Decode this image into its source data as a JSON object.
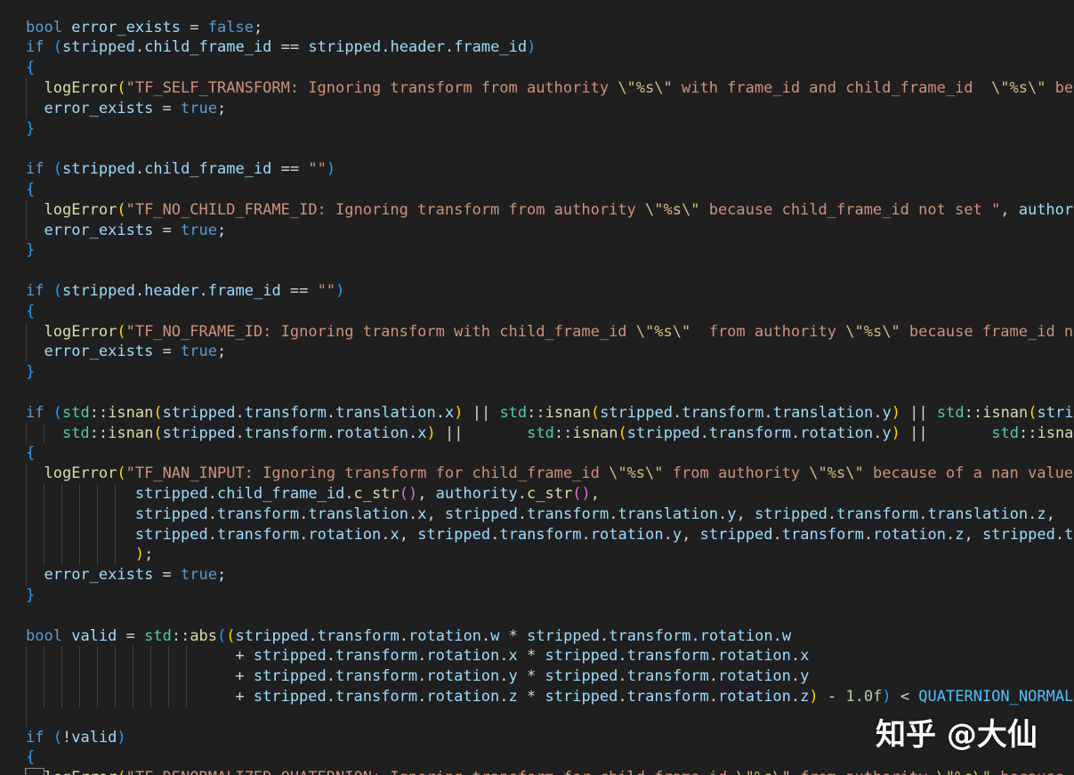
{
  "editor": {
    "colors": {
      "background": "#1f1f1f",
      "keyword": "#569cd6",
      "function": "#dcdcaa",
      "variable": "#9cdcfe",
      "string": "#ce9178",
      "escape": "#d7ba7d",
      "namespace": "#4ec9b0",
      "number": "#b5cea8",
      "bracket_level1": "#ffd700",
      "bracket_level2": "#da70d6",
      "bracket_level3": "#179fff"
    },
    "lines": [
      [
        [
          "k",
          "bool"
        ],
        [
          "p",
          " "
        ],
        [
          "v",
          "error_exists"
        ],
        [
          "p",
          " = "
        ],
        [
          "k",
          "false"
        ],
        [
          "p",
          ";"
        ]
      ],
      [
        [
          "k",
          "if"
        ],
        [
          "p",
          " "
        ],
        [
          "b3",
          "("
        ],
        [
          "v",
          "stripped"
        ],
        [
          "p",
          "."
        ],
        [
          "v",
          "child_frame_id"
        ],
        [
          "p",
          " == "
        ],
        [
          "v",
          "stripped"
        ],
        [
          "p",
          "."
        ],
        [
          "v",
          "header"
        ],
        [
          "p",
          "."
        ],
        [
          "v",
          "frame_id"
        ],
        [
          "b3",
          ")"
        ]
      ],
      [
        [
          "b3",
          "{"
        ]
      ],
      [
        [
          "p",
          "  "
        ],
        [
          "f",
          "logError"
        ],
        [
          "b1",
          "("
        ],
        [
          "s",
          "\"TF_SELF_TRANSFORM: Ignoring transform from authority "
        ],
        [
          "e",
          "\\\""
        ],
        [
          "e",
          "%s"
        ],
        [
          "e",
          "\\\""
        ],
        [
          "s",
          " with frame_id and child_frame_id  "
        ],
        [
          "e",
          "\\\""
        ],
        [
          "e",
          "%s"
        ],
        [
          "e",
          "\\\""
        ],
        [
          "s",
          " because they are the same\""
        ]
      ],
      [
        [
          "p",
          "  "
        ],
        [
          "v",
          "error_exists"
        ],
        [
          "p",
          " = "
        ],
        [
          "k",
          "true"
        ],
        [
          "p",
          ";"
        ]
      ],
      [
        [
          "b3",
          "}"
        ]
      ],
      [],
      [
        [
          "k",
          "if"
        ],
        [
          "p",
          " "
        ],
        [
          "b3",
          "("
        ],
        [
          "v",
          "stripped"
        ],
        [
          "p",
          "."
        ],
        [
          "v",
          "child_frame_id"
        ],
        [
          "p",
          " == "
        ],
        [
          "s",
          "\"\""
        ],
        [
          "b3",
          ")"
        ]
      ],
      [
        [
          "b3",
          "{"
        ]
      ],
      [
        [
          "p",
          "  "
        ],
        [
          "f",
          "logError"
        ],
        [
          "b1",
          "("
        ],
        [
          "s",
          "\"TF_NO_CHILD_FRAME_ID: Ignoring transform from authority "
        ],
        [
          "e",
          "\\\""
        ],
        [
          "e",
          "%s"
        ],
        [
          "e",
          "\\\""
        ],
        [
          "s",
          " because child_frame_id not set \""
        ],
        [
          "p",
          ", "
        ],
        [
          "v",
          "authority"
        ]
      ],
      [
        [
          "p",
          "  "
        ],
        [
          "v",
          "error_exists"
        ],
        [
          "p",
          " = "
        ],
        [
          "k",
          "true"
        ],
        [
          "p",
          ";"
        ]
      ],
      [
        [
          "b3",
          "}"
        ]
      ],
      [],
      [
        [
          "k",
          "if"
        ],
        [
          "p",
          " "
        ],
        [
          "b3",
          "("
        ],
        [
          "v",
          "stripped"
        ],
        [
          "p",
          "."
        ],
        [
          "v",
          "header"
        ],
        [
          "p",
          "."
        ],
        [
          "v",
          "frame_id"
        ],
        [
          "p",
          " == "
        ],
        [
          "s",
          "\"\""
        ],
        [
          "b3",
          ")"
        ]
      ],
      [
        [
          "b3",
          "{"
        ]
      ],
      [
        [
          "p",
          "  "
        ],
        [
          "f",
          "logError"
        ],
        [
          "b1",
          "("
        ],
        [
          "s",
          "\"TF_NO_FRAME_ID: Ignoring transform with child_frame_id "
        ],
        [
          "e",
          "\\\""
        ],
        [
          "e",
          "%s"
        ],
        [
          "e",
          "\\\""
        ],
        [
          "s",
          "  from authority "
        ],
        [
          "e",
          "\\\""
        ],
        [
          "e",
          "%s"
        ],
        [
          "e",
          "\\\""
        ],
        [
          "s",
          " because frame_id not set\""
        ]
      ],
      [
        [
          "p",
          "  "
        ],
        [
          "v",
          "error_exists"
        ],
        [
          "p",
          " = "
        ],
        [
          "k",
          "true"
        ],
        [
          "p",
          ";"
        ]
      ],
      [
        [
          "b3",
          "}"
        ]
      ],
      [],
      [
        [
          "k",
          "if"
        ],
        [
          "p",
          " "
        ],
        [
          "b3",
          "("
        ],
        [
          "c",
          "std"
        ],
        [
          "p",
          "::"
        ],
        [
          "f",
          "isnan"
        ],
        [
          "b1",
          "("
        ],
        [
          "v",
          "stripped"
        ],
        [
          "p",
          "."
        ],
        [
          "v",
          "transform"
        ],
        [
          "p",
          "."
        ],
        [
          "v",
          "translation"
        ],
        [
          "p",
          "."
        ],
        [
          "v",
          "x"
        ],
        [
          "b1",
          ")"
        ],
        [
          "p",
          " || "
        ],
        [
          "c",
          "std"
        ],
        [
          "p",
          "::"
        ],
        [
          "f",
          "isnan"
        ],
        [
          "b1",
          "("
        ],
        [
          "v",
          "stripped"
        ],
        [
          "p",
          "."
        ],
        [
          "v",
          "transform"
        ],
        [
          "p",
          "."
        ],
        [
          "v",
          "translation"
        ],
        [
          "p",
          "."
        ],
        [
          "v",
          "y"
        ],
        [
          "b1",
          ")"
        ],
        [
          "p",
          " || "
        ],
        [
          "c",
          "std"
        ],
        [
          "p",
          "::"
        ],
        [
          "f",
          "isnan"
        ],
        [
          "b1",
          "("
        ],
        [
          "v",
          "stripped"
        ]
      ],
      [
        [
          "p",
          "    "
        ],
        [
          "c",
          "std"
        ],
        [
          "p",
          "::"
        ],
        [
          "f",
          "isnan"
        ],
        [
          "b1",
          "("
        ],
        [
          "v",
          "stripped"
        ],
        [
          "p",
          "."
        ],
        [
          "v",
          "transform"
        ],
        [
          "p",
          "."
        ],
        [
          "v",
          "rotation"
        ],
        [
          "p",
          "."
        ],
        [
          "v",
          "x"
        ],
        [
          "b1",
          ")"
        ],
        [
          "p",
          " ||       "
        ],
        [
          "c",
          "std"
        ],
        [
          "p",
          "::"
        ],
        [
          "f",
          "isnan"
        ],
        [
          "b1",
          "("
        ],
        [
          "v",
          "stripped"
        ],
        [
          "p",
          "."
        ],
        [
          "v",
          "transform"
        ],
        [
          "p",
          "."
        ],
        [
          "v",
          "rotation"
        ],
        [
          "p",
          "."
        ],
        [
          "v",
          "y"
        ],
        [
          "b1",
          ")"
        ],
        [
          "p",
          " ||       "
        ],
        [
          "c",
          "std"
        ],
        [
          "p",
          "::"
        ],
        [
          "f",
          "isnan"
        ],
        [
          "b1",
          "("
        ]
      ],
      [
        [
          "b3",
          "{"
        ]
      ],
      [
        [
          "p",
          "  "
        ],
        [
          "f",
          "logError"
        ],
        [
          "b1",
          "("
        ],
        [
          "s",
          "\"TF_NAN_INPUT: Ignoring transform for child_frame_id "
        ],
        [
          "e",
          "\\\""
        ],
        [
          "e",
          "%s"
        ],
        [
          "e",
          "\\\""
        ],
        [
          "s",
          " from authority "
        ],
        [
          "e",
          "\\\""
        ],
        [
          "e",
          "%s"
        ],
        [
          "e",
          "\\\""
        ],
        [
          "s",
          " because of a nan value in the transform\""
        ]
      ],
      [
        [
          "p",
          "            "
        ],
        [
          "v",
          "stripped"
        ],
        [
          "p",
          "."
        ],
        [
          "v",
          "child_frame_id"
        ],
        [
          "p",
          "."
        ],
        [
          "f",
          "c_str"
        ],
        [
          "b2",
          "()"
        ],
        [
          "p",
          ", "
        ],
        [
          "v",
          "authority"
        ],
        [
          "p",
          "."
        ],
        [
          "f",
          "c_str"
        ],
        [
          "b2",
          "()"
        ],
        [
          "p",
          ","
        ]
      ],
      [
        [
          "p",
          "            "
        ],
        [
          "v",
          "stripped"
        ],
        [
          "p",
          "."
        ],
        [
          "v",
          "transform"
        ],
        [
          "p",
          "."
        ],
        [
          "v",
          "translation"
        ],
        [
          "p",
          "."
        ],
        [
          "v",
          "x"
        ],
        [
          "p",
          ", "
        ],
        [
          "v",
          "stripped"
        ],
        [
          "p",
          "."
        ],
        [
          "v",
          "transform"
        ],
        [
          "p",
          "."
        ],
        [
          "v",
          "translation"
        ],
        [
          "p",
          "."
        ],
        [
          "v",
          "y"
        ],
        [
          "p",
          ", "
        ],
        [
          "v",
          "stripped"
        ],
        [
          "p",
          "."
        ],
        [
          "v",
          "transform"
        ],
        [
          "p",
          "."
        ],
        [
          "v",
          "translation"
        ],
        [
          "p",
          "."
        ],
        [
          "v",
          "z"
        ],
        [
          "p",
          ","
        ]
      ],
      [
        [
          "p",
          "            "
        ],
        [
          "v",
          "stripped"
        ],
        [
          "p",
          "."
        ],
        [
          "v",
          "transform"
        ],
        [
          "p",
          "."
        ],
        [
          "v",
          "rotation"
        ],
        [
          "p",
          "."
        ],
        [
          "v",
          "x"
        ],
        [
          "p",
          ", "
        ],
        [
          "v",
          "stripped"
        ],
        [
          "p",
          "."
        ],
        [
          "v",
          "transform"
        ],
        [
          "p",
          "."
        ],
        [
          "v",
          "rotation"
        ],
        [
          "p",
          "."
        ],
        [
          "v",
          "y"
        ],
        [
          "p",
          ", "
        ],
        [
          "v",
          "stripped"
        ],
        [
          "p",
          "."
        ],
        [
          "v",
          "transform"
        ],
        [
          "p",
          "."
        ],
        [
          "v",
          "rotation"
        ],
        [
          "p",
          "."
        ],
        [
          "v",
          "z"
        ],
        [
          "p",
          ", "
        ],
        [
          "v",
          "stripped"
        ],
        [
          "p",
          "."
        ],
        [
          "v",
          "transform"
        ]
      ],
      [
        [
          "p",
          "            "
        ],
        [
          "b1",
          ")"
        ],
        [
          "p",
          ";"
        ]
      ],
      [
        [
          "p",
          "  "
        ],
        [
          "v",
          "error_exists"
        ],
        [
          "p",
          " = "
        ],
        [
          "k",
          "true"
        ],
        [
          "p",
          ";"
        ]
      ],
      [
        [
          "b3",
          "}"
        ]
      ],
      [],
      [
        [
          "k",
          "bool"
        ],
        [
          "p",
          " "
        ],
        [
          "v",
          "valid"
        ],
        [
          "p",
          " = "
        ],
        [
          "c",
          "std"
        ],
        [
          "p",
          "::"
        ],
        [
          "f",
          "abs"
        ],
        [
          "b3",
          "("
        ],
        [
          "b1",
          "("
        ],
        [
          "v",
          "stripped"
        ],
        [
          "p",
          "."
        ],
        [
          "v",
          "transform"
        ],
        [
          "p",
          "."
        ],
        [
          "v",
          "rotation"
        ],
        [
          "p",
          "."
        ],
        [
          "v",
          "w"
        ],
        [
          "p",
          " * "
        ],
        [
          "v",
          "stripped"
        ],
        [
          "p",
          "."
        ],
        [
          "v",
          "transform"
        ],
        [
          "p",
          "."
        ],
        [
          "v",
          "rotation"
        ],
        [
          "p",
          "."
        ],
        [
          "v",
          "w"
        ]
      ],
      [
        [
          "p",
          "                       + "
        ],
        [
          "v",
          "stripped"
        ],
        [
          "p",
          "."
        ],
        [
          "v",
          "transform"
        ],
        [
          "p",
          "."
        ],
        [
          "v",
          "rotation"
        ],
        [
          "p",
          "."
        ],
        [
          "v",
          "x"
        ],
        [
          "p",
          " * "
        ],
        [
          "v",
          "stripped"
        ],
        [
          "p",
          "."
        ],
        [
          "v",
          "transform"
        ],
        [
          "p",
          "."
        ],
        [
          "v",
          "rotation"
        ],
        [
          "p",
          "."
        ],
        [
          "v",
          "x"
        ]
      ],
      [
        [
          "p",
          "                       + "
        ],
        [
          "v",
          "stripped"
        ],
        [
          "p",
          "."
        ],
        [
          "v",
          "transform"
        ],
        [
          "p",
          "."
        ],
        [
          "v",
          "rotation"
        ],
        [
          "p",
          "."
        ],
        [
          "v",
          "y"
        ],
        [
          "p",
          " * "
        ],
        [
          "v",
          "stripped"
        ],
        [
          "p",
          "."
        ],
        [
          "v",
          "transform"
        ],
        [
          "p",
          "."
        ],
        [
          "v",
          "rotation"
        ],
        [
          "p",
          "."
        ],
        [
          "v",
          "y"
        ]
      ],
      [
        [
          "p",
          "                       + "
        ],
        [
          "v",
          "stripped"
        ],
        [
          "p",
          "."
        ],
        [
          "v",
          "transform"
        ],
        [
          "p",
          "."
        ],
        [
          "v",
          "rotation"
        ],
        [
          "p",
          "."
        ],
        [
          "v",
          "z"
        ],
        [
          "p",
          " * "
        ],
        [
          "v",
          "stripped"
        ],
        [
          "p",
          "."
        ],
        [
          "v",
          "transform"
        ],
        [
          "p",
          "."
        ],
        [
          "v",
          "rotation"
        ],
        [
          "p",
          "."
        ],
        [
          "v",
          "z"
        ],
        [
          "b1",
          ")"
        ],
        [
          "p",
          " - "
        ],
        [
          "n",
          "1.0f"
        ],
        [
          "b3",
          ")"
        ],
        [
          "p",
          " < "
        ],
        [
          "m",
          "QUATERNION_NORMALIZATION_TOLERANCE"
        ],
        [
          "p",
          ";"
        ]
      ],
      [],
      [
        [
          "k",
          "if"
        ],
        [
          "p",
          " "
        ],
        [
          "b3",
          "("
        ],
        [
          "p",
          "!"
        ],
        [
          "v",
          "valid"
        ],
        [
          "b3",
          ")"
        ]
      ],
      [
        [
          "b3",
          "{"
        ]
      ],
      [
        [
          "p",
          "  "
        ],
        [
          "f",
          "logError"
        ],
        [
          "b1",
          "("
        ],
        [
          "s",
          "\"TF_DENORMALIZED_QUATERNION: Ignoring transform for child_frame_id "
        ],
        [
          "e",
          "\\\""
        ],
        [
          "e",
          "%s"
        ],
        [
          "e",
          "\\\""
        ],
        [
          "s",
          " from authority "
        ],
        [
          "e",
          "\\\""
        ],
        [
          "e",
          "%s"
        ],
        [
          "e",
          "\\\""
        ],
        [
          "s",
          " because of an invalid quaternion\""
        ]
      ]
    ]
  },
  "watermark": {
    "text": "知乎 @大仙"
  }
}
